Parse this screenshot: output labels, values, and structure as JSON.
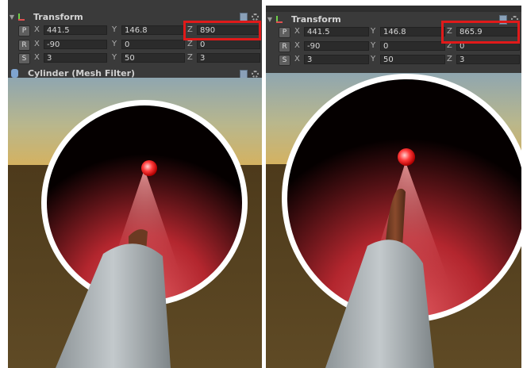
{
  "left": {
    "transform": {
      "title": "Transform",
      "position": {
        "button": "P",
        "x_label": "X",
        "x": "441.5",
        "y_label": "Y",
        "y": "146.8",
        "z_label": "Z",
        "z": "890"
      },
      "rotation": {
        "button": "R",
        "x_label": "X",
        "x": "-90",
        "y_label": "Y",
        "y": "0",
        "z_label": "Z",
        "z": "0"
      },
      "scale": {
        "button": "S",
        "x_label": "X",
        "x": "3",
        "y_label": "Y",
        "y": "50",
        "z_label": "Z",
        "z": "3"
      }
    },
    "mesh_filter_title": "Cylinder (Mesh Filter)"
  },
  "right": {
    "transform": {
      "title": "Transform",
      "position": {
        "button": "P",
        "x_label": "X",
        "x": "441.5",
        "y_label": "Y",
        "y": "146.8",
        "z_label": "Z",
        "z": "865.9"
      },
      "rotation": {
        "button": "R",
        "x_label": "X",
        "x": "-90",
        "y_label": "Y",
        "y": "0",
        "z_label": "Z",
        "z": "0"
      },
      "scale": {
        "button": "S",
        "x_label": "X",
        "x": "3",
        "y_label": "Y",
        "y": "50",
        "z_label": "Z",
        "z": "3"
      }
    }
  },
  "icons": [
    "transform-icon",
    "book-icon",
    "gear-icon",
    "cylinder-icon"
  ],
  "colors": {
    "inspector_bg": "#3a3a3a",
    "field_bg": "#2b2b2b",
    "highlight": "#e01a1a",
    "sky": "#9fb2b6",
    "ground": "#5a4522",
    "ring": "#ffffff",
    "glow": "#d83c46",
    "cylinder": "#9ea5a8",
    "stick": "#6b3a22"
  }
}
